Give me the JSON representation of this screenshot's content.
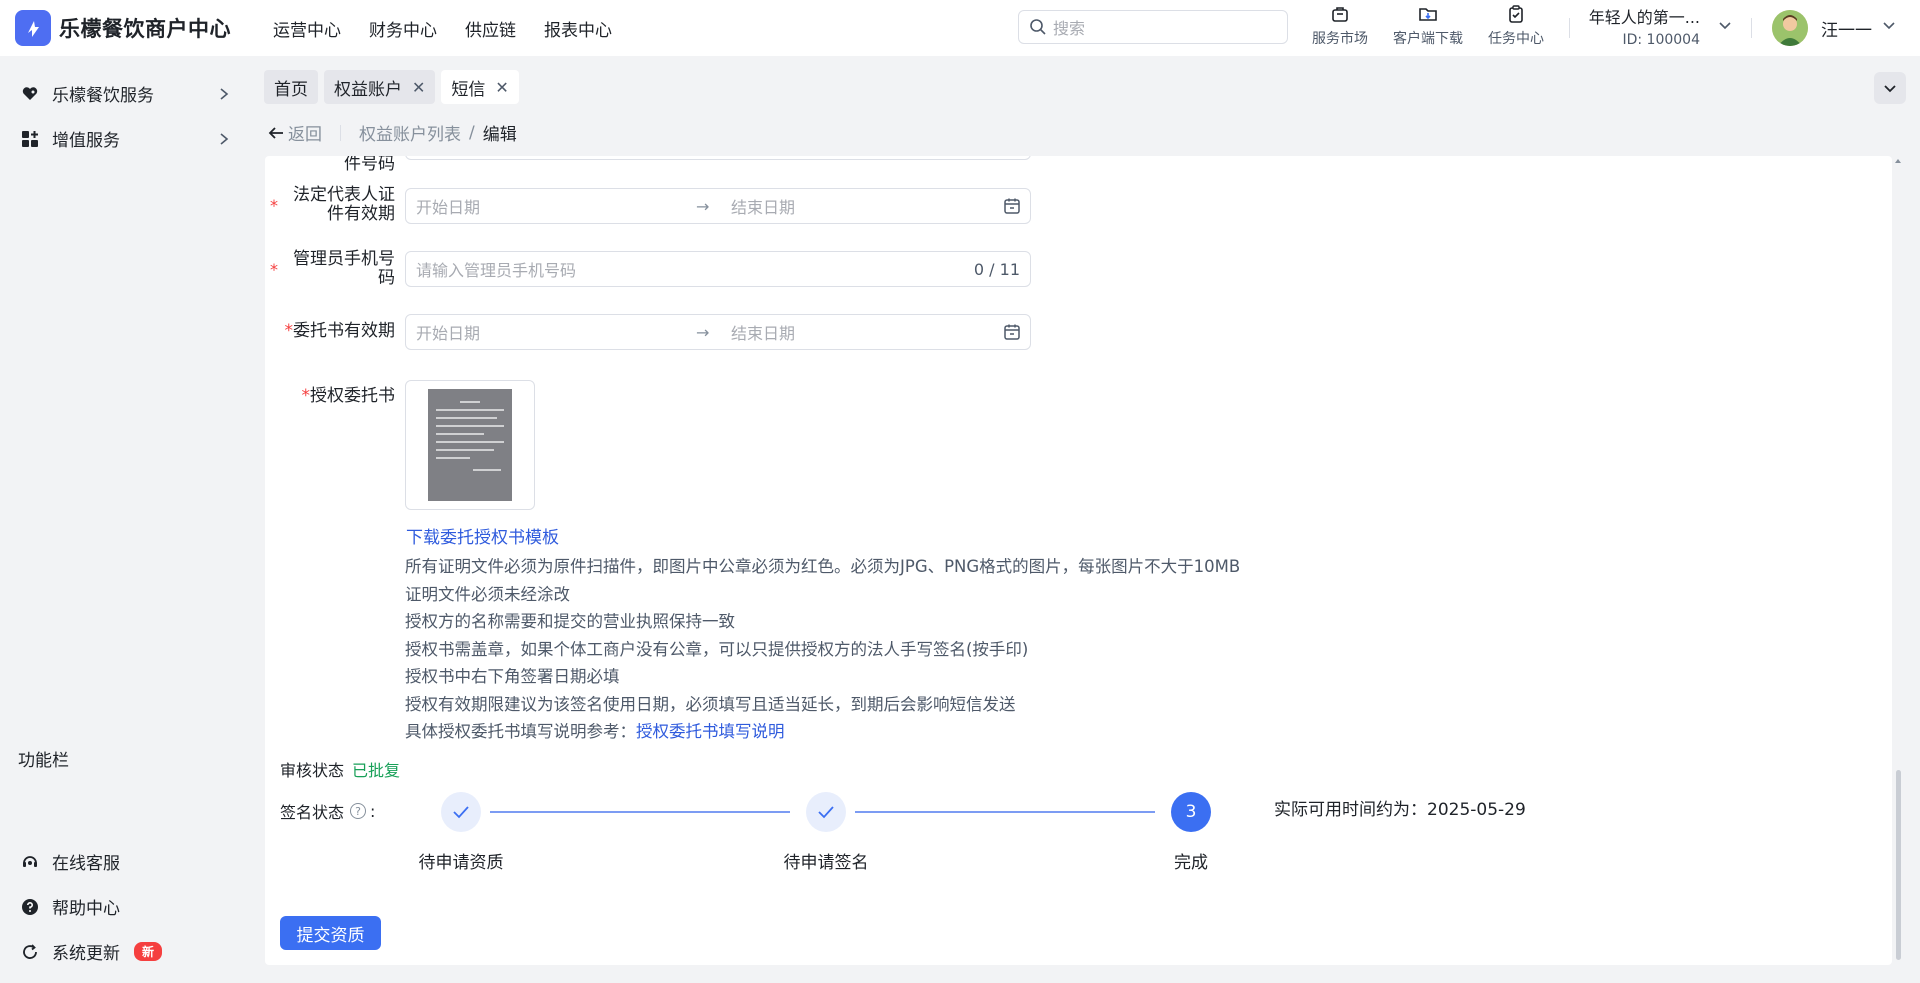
{
  "app": {
    "title": "乐檬餐饮商户中心"
  },
  "topnav": [
    "运营中心",
    "财务中心",
    "供应链",
    "报表中心"
  ],
  "search": {
    "placeholder": "搜索"
  },
  "tools": [
    {
      "label": "服务市场",
      "icon": "shop-bag-icon"
    },
    {
      "label": "客户端下载",
      "icon": "folder-download-icon"
    },
    {
      "label": "任务中心",
      "icon": "clipboard-check-icon"
    }
  ],
  "org": {
    "name": "年轻人的第一...",
    "id": "ID: 100004"
  },
  "user": {
    "name": "汪一一"
  },
  "sidebar": {
    "items": [
      {
        "label": "乐檬餐饮服务",
        "icon": "heart-hand-icon"
      },
      {
        "label": "增值服务",
        "icon": "grid-plus-icon"
      }
    ],
    "section_title": "功能栏",
    "bottom_items": [
      {
        "label": "在线客服",
        "icon": "headset-icon"
      },
      {
        "label": "帮助中心",
        "icon": "help-circle-icon"
      },
      {
        "label": "系统更新",
        "icon": "refresh-icon",
        "badge": "新"
      }
    ]
  },
  "tabs": [
    {
      "label": "首页",
      "closable": false
    },
    {
      "label": "权益账户",
      "closable": true
    },
    {
      "label": "短信",
      "closable": true,
      "active": true
    }
  ],
  "breadcrumb": {
    "back": "返回",
    "parent": "权益账户列表",
    "separator": "/",
    "current": "编辑"
  },
  "form": {
    "top_cut_label": "件号码",
    "legal_rep_validity": {
      "label_line1": "法定代表人证",
      "label_line2": "件有效期",
      "start_placeholder": "开始日期",
      "end_placeholder": "结束日期",
      "arrow": "→"
    },
    "admin_phone": {
      "label_line1": "管理员手机号",
      "label_line2": "码",
      "placeholder": "请输入管理员手机号码",
      "counter": "0 / 11"
    },
    "entrust_validity": {
      "label": "委托书有效期",
      "start_placeholder": "开始日期",
      "end_placeholder": "结束日期",
      "arrow": "→"
    },
    "auth_letter": {
      "label": "授权委托书",
      "template_link": "下载委托授权书模板"
    },
    "notes": [
      "所有证明文件必须为原件扫描件，即图片中公章必须为红色。必须为JPG、PNG格式的图片，每张图片不大于10MB",
      "证明文件必须未经涂改",
      "授权方的名称需要和提交的营业执照保持一致",
      "授权书需盖章，如果个体工商户没有公章，可以只提供授权方的法人手写签名(按手印)",
      "授权书中右下角签署日期必填",
      "授权有效期限建议为该签名使用日期，必须填写且适当延长，到期后会影响短信发送"
    ],
    "ref_note": "具体授权委托书填写说明参考：",
    "ref_link": "授权委托书填写说明"
  },
  "audit": {
    "label": "审核状态",
    "value": "已批复",
    "value_color": "#18a058"
  },
  "sign_status": {
    "label": "签名状态",
    "colon": ":",
    "steps": [
      {
        "label": "待申请资质",
        "state": "done"
      },
      {
        "label": "待申请签名",
        "state": "done"
      },
      {
        "label": "完成",
        "state": "current",
        "number": "3"
      }
    ],
    "available_text": "实际可用时间约为：2025-05-29"
  },
  "submit_label": "提交资质",
  "colors": {
    "primary": "#3b6ff2",
    "link": "#2f5bdd",
    "required": "#f53f3f",
    "badge": "#f53f3f"
  }
}
